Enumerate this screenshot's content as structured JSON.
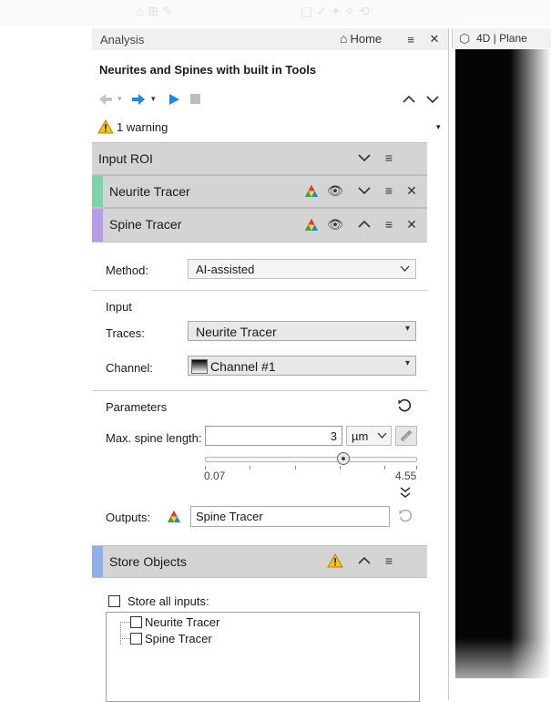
{
  "panel": {
    "title": "Analysis",
    "home_label": "Home",
    "pipeline_title": "Neurites and Spines with built in Tools",
    "warning_text": "1 warning"
  },
  "viewer": {
    "tab_label": "4D | Plane"
  },
  "sections": {
    "input_roi": {
      "label": "Input ROI"
    },
    "neurite_tracer": {
      "label": "Neurite Tracer",
      "color": "#7fd3a8"
    },
    "spine_tracer": {
      "label": "Spine Tracer",
      "color": "#b59be8"
    },
    "store_objects": {
      "label": "Store Objects",
      "color": "#8fb0ea"
    }
  },
  "spine_tracer": {
    "method_label": "Method:",
    "method_value": "AI-assisted",
    "input_heading": "Input",
    "traces_label": "Traces:",
    "traces_value": "Neurite Tracer",
    "channel_label": "Channel:",
    "channel_value": "Channel #1",
    "parameters_heading": "Parameters",
    "max_spine_label": "Max. spine length:",
    "max_spine_value": "3",
    "unit_value": "µm",
    "slider_min": "0.07",
    "slider_max": "4.55",
    "slider_value": 3,
    "outputs_label": "Outputs:",
    "outputs_value": "Spine Tracer"
  },
  "store_objects": {
    "store_all_label": "Store all inputs:",
    "items": [
      "Neurite Tracer",
      "Spine Tracer"
    ]
  },
  "colors": {
    "header_bg": "#d4d4d4",
    "accent_blue": "#1e88e5",
    "warning_yellow": "#f5c518"
  },
  "icons": [
    "home-icon",
    "menu-icon",
    "close-icon",
    "back-arrow-icon",
    "forward-arrow-icon",
    "play-icon",
    "stop-icon",
    "chevron-up-icon",
    "chevron-down-icon",
    "warning-icon",
    "eye-icon",
    "color-triangle-icon",
    "reset-icon",
    "ruler-icon",
    "double-chevron-down-icon",
    "cube-icon"
  ]
}
